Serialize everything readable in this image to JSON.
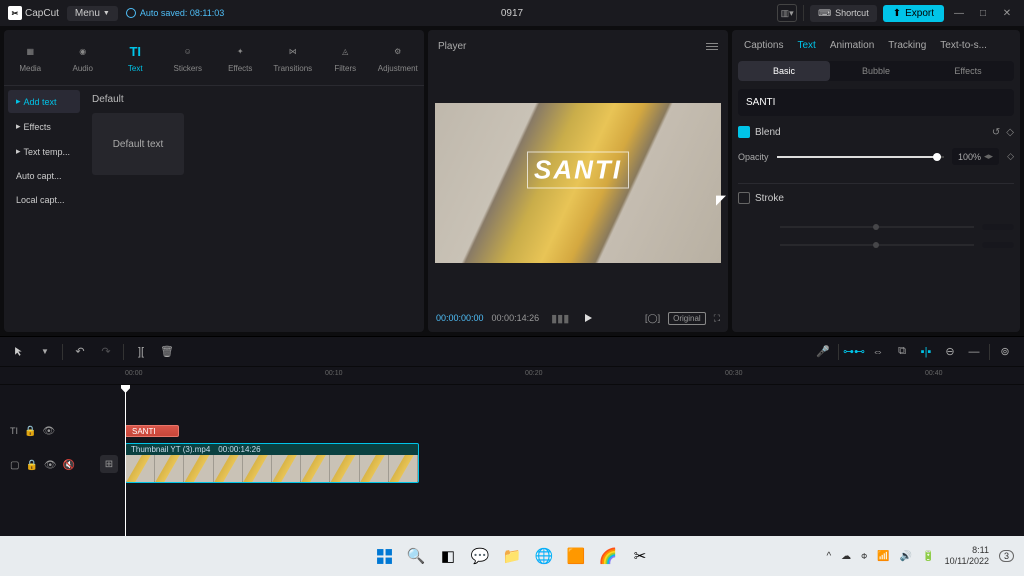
{
  "app": {
    "name": "CapCut",
    "menu": "Menu",
    "autosave": "Auto saved: 08:11:03",
    "project_title": "0917"
  },
  "topbar": {
    "shortcut": "Shortcut",
    "export": "Export"
  },
  "asset_tabs": [
    {
      "label": "Media"
    },
    {
      "label": "Audio"
    },
    {
      "label": "Text"
    },
    {
      "label": "Stickers"
    },
    {
      "label": "Effects"
    },
    {
      "label": "Transitions"
    },
    {
      "label": "Filters"
    },
    {
      "label": "Adjustment"
    }
  ],
  "sidebar": {
    "items": [
      {
        "label": "Add text",
        "arrow": "▸"
      },
      {
        "label": "Effects",
        "arrow": "▸"
      },
      {
        "label": "Text temp...",
        "arrow": "▸"
      },
      {
        "label": "Auto capt..."
      },
      {
        "label": "Local capt..."
      }
    ]
  },
  "content": {
    "header": "Default",
    "thumb": "Default text"
  },
  "player": {
    "title": "Player",
    "overlay_text": "SANTI",
    "tc_current": "00:00:00:00",
    "tc_total": "00:00:14:26",
    "quality": "Original"
  },
  "right": {
    "tabs": [
      "Captions",
      "Text",
      "Animation",
      "Tracking",
      "Text-to-s..."
    ],
    "active_tab": 1,
    "subtabs": [
      "Basic",
      "Bubble",
      "Effects"
    ],
    "text_value": "SANTI",
    "blend_label": "Blend",
    "opacity_label": "Opacity",
    "opacity_value": "100%",
    "stroke_label": "Stroke"
  },
  "timeline": {
    "ticks": [
      "00:00",
      "00:10",
      "00:20",
      "00:30",
      "00:40"
    ],
    "text_clip": "SANTI",
    "video_clip_name": "Thumbnail YT (3).mp4",
    "video_clip_duration": "00:00:14:26"
  },
  "taskbar": {
    "time": "8:11",
    "date": "10/11/2022"
  }
}
